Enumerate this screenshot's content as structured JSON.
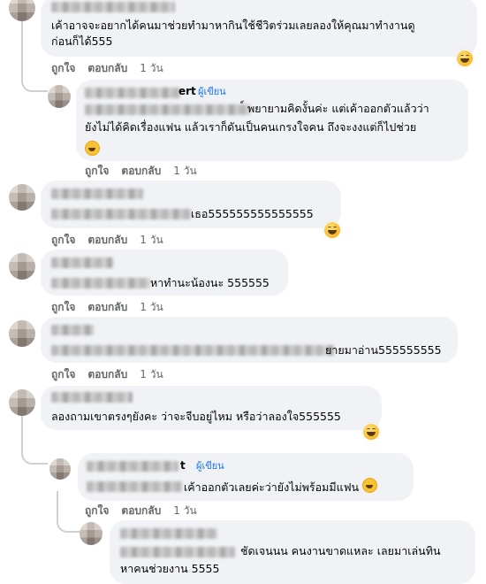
{
  "actions": {
    "like": "ถูกใจ",
    "reply": "ตอบกลับ",
    "time": "1 วัน"
  },
  "author_badge": "ผู้เขียน",
  "comments": [
    {
      "line1": "เค้าอาจจะอยากได้คนมาช่วยทำมาหากินใช้ชีวิตร่วมเลยลองให้คุณมาทำงานดู",
      "line2": "ก่อนก็ได้555"
    },
    {
      "name_tail": "ert",
      "line1": "์ พยายามคิดงั้นค่ะ แต่เค้าออกตัวแล้วว่า",
      "line2": "ยังไม่ได้คิดเรื่องแฟน แล้วเราก็ดันเป็นคนเกรงใจคน ถึงจะงงแต่ก็ไปช่วย"
    },
    {
      "text": "เธอ555555555555555"
    },
    {
      "text": "หาทำนะน้องนะ 555555"
    },
    {
      "text": "ยายมาอ่าน555555555"
    },
    {
      "text": "ลองถามเขาตรงๆยังคะ ว่าจะจีบอยู่ไหม หรือว่าลองใจ555555"
    },
    {
      "name_tail": "t",
      "text": "เค้าออกตัวเลยค่ะว่ายังไม่พร้อมมีแฟน"
    },
    {
      "line1": "ชัดเจนนน คนงานขาดแหละ เลยมาเล่นทิน",
      "line2": "หาคนช่วยงาน 5555"
    }
  ],
  "icons": {
    "reaction": "laughing-emoji-icon",
    "inline": "grinning-emoji-icon",
    "avatar": "blurred-avatar"
  }
}
